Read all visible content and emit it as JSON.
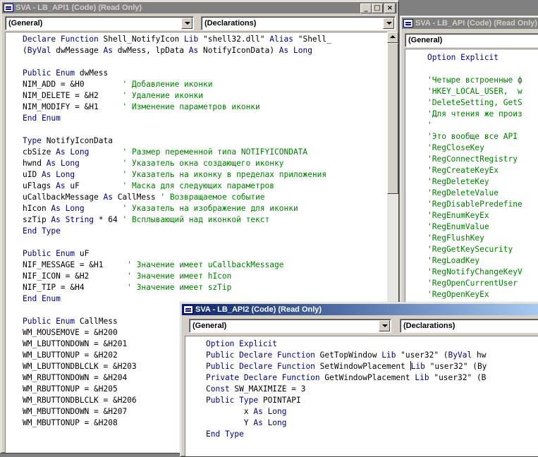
{
  "window1": {
    "title": "SVA - LB_API1 (Code)  (Read Only)",
    "object_combo": "(General)",
    "proc_combo": "(Declarations)",
    "lines": [
      [
        {
          "t": "Declare Function",
          "k": 1
        },
        {
          "t": " Shell_NotifyIcon "
        },
        {
          "t": "Lib",
          "k": 1
        },
        {
          "t": " \"shell32.dll\" "
        },
        {
          "t": "Alias",
          "k": 1
        },
        {
          "t": " \"Shell_"
        }
      ],
      [
        {
          "t": "("
        },
        {
          "t": "ByVal",
          "k": 1
        },
        {
          "t": " dwMessage "
        },
        {
          "t": "As",
          "k": 1
        },
        {
          "t": " dwMess, lpData "
        },
        {
          "t": "As",
          "k": 1
        },
        {
          "t": " NotifyIconData) "
        },
        {
          "t": "As Long",
          "k": 1
        }
      ],
      [],
      [
        {
          "t": "Public Enum",
          "k": 1
        },
        {
          "t": " dwMess"
        }
      ],
      [
        {
          "t": "NIM_ADD = &H0        "
        },
        {
          "t": "' Добавление иконки",
          "c": 1
        }
      ],
      [
        {
          "t": "NIM_DELETE = &H2     "
        },
        {
          "t": "' Удаление иконки",
          "c": 1
        }
      ],
      [
        {
          "t": "NIM_MODIFY = &H1     "
        },
        {
          "t": "' Изменение параметров иконки",
          "c": 1
        }
      ],
      [
        {
          "t": "End Enum",
          "k": 1
        }
      ],
      [],
      [
        {
          "t": "Type",
          "k": 1
        },
        {
          "t": " NotifyIconData"
        }
      ],
      [
        {
          "t": "cbSize "
        },
        {
          "t": "As Long",
          "k": 1
        },
        {
          "t": "       "
        },
        {
          "t": "' Размер переменной типа NOTIFYICONDATA",
          "c": 1
        }
      ],
      [
        {
          "t": "hwnd "
        },
        {
          "t": "As Long",
          "k": 1
        },
        {
          "t": "         "
        },
        {
          "t": "' Указатель окна создающего иконку",
          "c": 1
        }
      ],
      [
        {
          "t": "uID "
        },
        {
          "t": "As Long",
          "k": 1
        },
        {
          "t": "          "
        },
        {
          "t": "' Указатель на иконку в пределах приложения",
          "c": 1
        }
      ],
      [
        {
          "t": "uFlags "
        },
        {
          "t": "As",
          "k": 1
        },
        {
          "t": " uF         "
        },
        {
          "t": "' Маска для следующих параметров",
          "c": 1
        }
      ],
      [
        {
          "t": "uCallbackMessage "
        },
        {
          "t": "As",
          "k": 1
        },
        {
          "t": " CallMess "
        },
        {
          "t": "' Возвращаемое событие",
          "c": 1
        }
      ],
      [
        {
          "t": "hIcon "
        },
        {
          "t": "As Long",
          "k": 1
        },
        {
          "t": "        "
        },
        {
          "t": "' Указатель на изображение для иконки",
          "c": 1
        }
      ],
      [
        {
          "t": "szTip "
        },
        {
          "t": "As String",
          "k": 1
        },
        {
          "t": " * 64 "
        },
        {
          "t": "' Всплывающий над иконкой текст",
          "c": 1
        }
      ],
      [
        {
          "t": "End Type",
          "k": 1
        }
      ],
      [],
      [
        {
          "t": "Public Enum",
          "k": 1
        },
        {
          "t": " uF"
        }
      ],
      [
        {
          "t": "NIF_MESSAGE = &H1     "
        },
        {
          "t": "' Значение имеет uCallbackMessage",
          "c": 1
        }
      ],
      [
        {
          "t": "NIF_ICON = &H2        "
        },
        {
          "t": "' Значение имеет hIcon",
          "c": 1
        }
      ],
      [
        {
          "t": "NIF_TIP = &H4         "
        },
        {
          "t": "' Значение имеет szTip",
          "c": 1
        }
      ],
      [
        {
          "t": "End Enum",
          "k": 1
        }
      ],
      [],
      [
        {
          "t": "Public Enum",
          "k": 1
        },
        {
          "t": " CallMess"
        }
      ],
      [
        {
          "t": "WM_MOUSEMOVE = &H200"
        }
      ],
      [
        {
          "t": "WM_LBUTTONDOWN = &H201"
        }
      ],
      [
        {
          "t": "WM_LBUTTONUP = &H202"
        }
      ],
      [
        {
          "t": "WM_LBUTTONDBLCLK = &H203"
        }
      ],
      [
        {
          "t": "WM_RBUTTONDOWN = &H204"
        }
      ],
      [
        {
          "t": "WM_RBUTTONUP = &H205"
        }
      ],
      [
        {
          "t": "WM_RBUTTONDBLCLK = &H206"
        }
      ],
      [
        {
          "t": "WM_MBUTTONDOWN = &H207"
        }
      ],
      [
        {
          "t": "WM_MBUTTONUP = &H208"
        }
      ]
    ]
  },
  "window2": {
    "title": "SVA - LB_API (Code)  (Read Only)",
    "object_combo": "(General)",
    "lines": [
      [
        {
          "t": "Option Explicit",
          "k": 1
        }
      ],
      [],
      [
        {
          "t": "'Четыре встроенные ф",
          "c": 1
        }
      ],
      [
        {
          "t": "'HKEY_LOCAL_USER,  w",
          "c": 1
        }
      ],
      [
        {
          "t": "'DeleteSetting, GetS",
          "c": 1
        }
      ],
      [
        {
          "t": "'Для чтения же произ",
          "c": 1
        }
      ],
      [
        {
          "t": "'",
          "c": 1
        }
      ],
      [
        {
          "t": "'Это вообще все API ",
          "c": 1
        }
      ],
      [
        {
          "t": "'RegCloseKey",
          "c": 1
        }
      ],
      [
        {
          "t": "'RegConnectRegistry",
          "c": 1
        }
      ],
      [
        {
          "t": "'RegCreateKeyEx",
          "c": 1
        }
      ],
      [
        {
          "t": "'RegDeleteKey",
          "c": 1
        }
      ],
      [
        {
          "t": "'RegDeleteValue",
          "c": 1
        }
      ],
      [
        {
          "t": "'RegDisablePredefine",
          "c": 1
        }
      ],
      [
        {
          "t": "'RegEnumKeyEx",
          "c": 1
        }
      ],
      [
        {
          "t": "'RegEnumValue",
          "c": 1
        }
      ],
      [
        {
          "t": "'RegFlushKey",
          "c": 1
        }
      ],
      [
        {
          "t": "'RegGetKeySecurity",
          "c": 1
        }
      ],
      [
        {
          "t": "'RegLoadKey",
          "c": 1
        }
      ],
      [
        {
          "t": "'RegNotifyChangeKeyV",
          "c": 1
        }
      ],
      [
        {
          "t": "'RegOpenCurrentUser",
          "c": 1
        }
      ],
      [
        {
          "t": "'RegOpenKeyEx",
          "c": 1
        }
      ]
    ]
  },
  "window3": {
    "title": "SVA - LB_API2 (Code)  (Read Only)",
    "object_combo": "(General)",
    "proc_combo": "(Declarations)",
    "lines": [
      [
        {
          "t": "Option Explicit",
          "k": 1
        }
      ],
      [
        {
          "t": "Public Declare Function",
          "k": 1
        },
        {
          "t": " GetTopWindow "
        },
        {
          "t": "Lib",
          "k": 1
        },
        {
          "t": " \"user32\" ("
        },
        {
          "t": "ByVal",
          "k": 1
        },
        {
          "t": " hw"
        }
      ],
      [
        {
          "t": "Public Declare Function",
          "k": 1
        },
        {
          "t": " SetWindowPlacement "
        },
        {
          "t": "",
          "cursor": 1
        },
        {
          "t": "Lib",
          "k": 1
        },
        {
          "t": " \"user32\" (By"
        }
      ],
      [
        {
          "t": "Private Declare Function",
          "k": 1
        },
        {
          "t": " GetWindowPlacement "
        },
        {
          "t": "Lib",
          "k": 1
        },
        {
          "t": " \"user32\" (B"
        }
      ],
      [
        {
          "t": "Const",
          "k": 1
        },
        {
          "t": " SW_MAXIMIZE = 3"
        }
      ],
      [
        {
          "t": "Public Type",
          "k": 1
        },
        {
          "t": " POINTAPI"
        }
      ],
      [
        {
          "t": "        x "
        },
        {
          "t": "As Long",
          "k": 1
        }
      ],
      [
        {
          "t": "        Y "
        },
        {
          "t": "As Long",
          "k": 1
        }
      ],
      [
        {
          "t": "End Type",
          "k": 1
        }
      ]
    ]
  }
}
